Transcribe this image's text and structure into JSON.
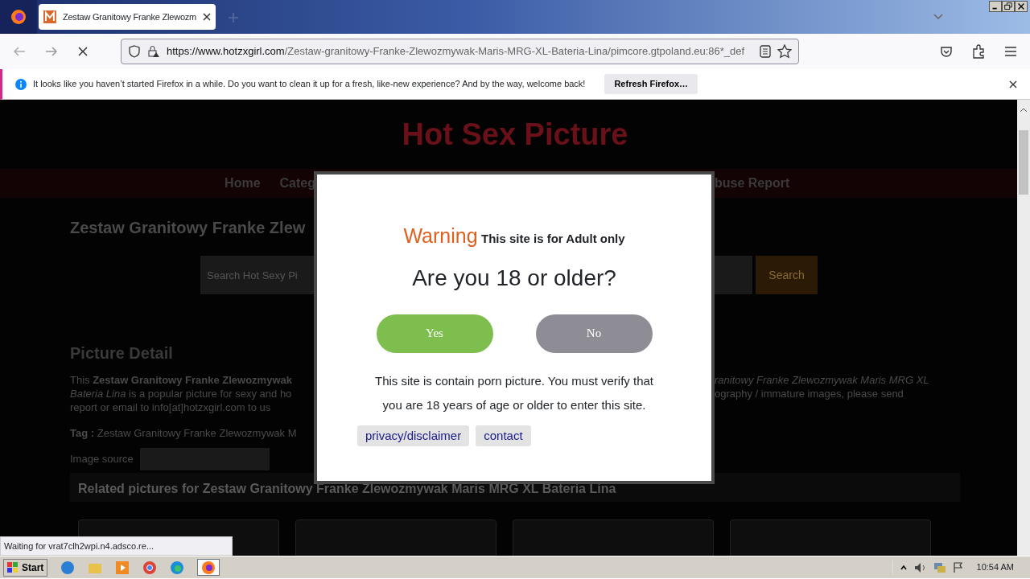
{
  "browser": {
    "tab_title": "Zestaw Granitowy Franke Zlewozm",
    "url_host": "https://www.hotzxgirl.com",
    "url_path": "/Zestaw-granitowy-Franke-Zlewozmywak-Maris-MRG-XL-Bateria-Lina/pimcore.gtpoland.eu:86*_def",
    "notification": "It looks like you haven’t started Firefox in a while. Do you want to clean it up for a fresh, like-new experience? And by the way, welcome back!",
    "notification_button": "Refresh Firefox…",
    "status": "Waiting for vrat7clh2wpi.n4.adsco.re..."
  },
  "site": {
    "title": "Hot Sex Picture",
    "nav_left": [
      "Home",
      "Categ"
    ],
    "nav_right": [
      "buse Report"
    ],
    "heading": "Zestaw Granitowy Franke Zlew",
    "search": {
      "placeholder": "Search Hot Sexy Pi",
      "button": "Search"
    },
    "detail_title": "Picture Detail",
    "detail_left": [
      "This **Zestaw Granitowy Franke Zlewozmywak**",
      "*Bateria Lina* is a popular picture for sexy and ho",
      "report or email to info[at]hotzxgirl.com to us"
    ],
    "detail_right": [
      "*ranitowy Franke Zlewozmywak Maris MRG XL*",
      "ography / immature images, please send"
    ],
    "tag_label": "Tag :",
    "tag_value": "Zestaw Granitowy Franke Zlewozmywak M",
    "image_source": "Image source",
    "related_title": "Related pictures for Zestaw Granitowy Franke Zlewozmywak Maris MRG XL Bateria Lina"
  },
  "modal": {
    "warning": "Warning",
    "warning_note": "This site is for Adult only",
    "question": "Are you 18 or older?",
    "buttons": [
      {
        "label": "Yes",
        "kind": "yes"
      },
      {
        "label": "No",
        "kind": "no"
      }
    ],
    "message": "This site is contain porn picture. You must verify that you are 18 years of age or older to enter this site.",
    "links": [
      "privacy/disclaimer",
      "contact"
    ]
  },
  "taskbar": {
    "start": "Start",
    "clock": "10:54 AM"
  }
}
